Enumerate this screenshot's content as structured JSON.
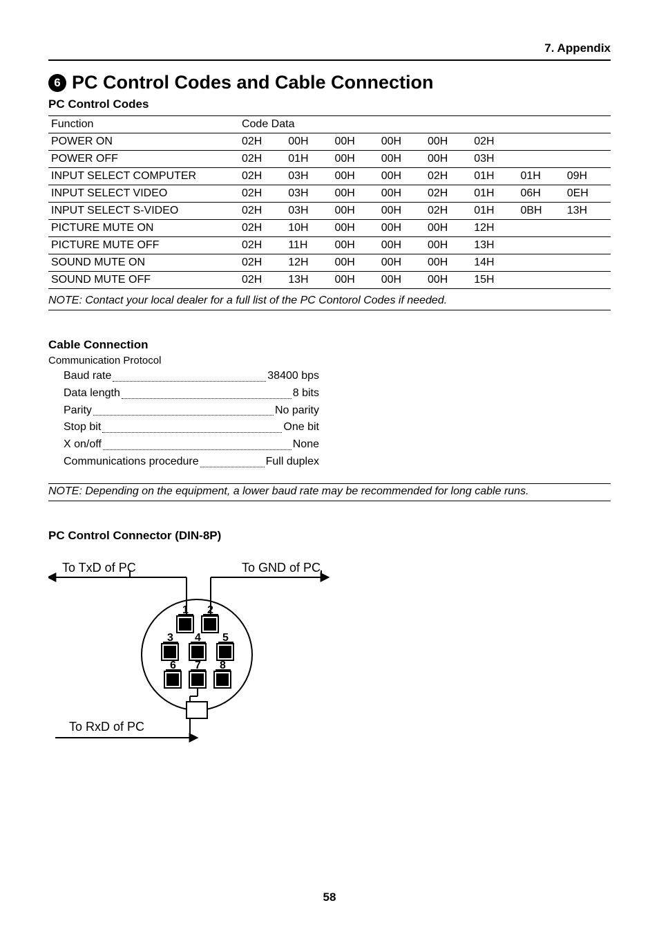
{
  "appendix_label": "7. Appendix",
  "section_number": "6",
  "main_title": "PC Control Codes and Cable Connection",
  "codes_title": "PC Control Codes",
  "codes_header_function": "Function",
  "codes_header_codedata": "Code Data",
  "chart_data": {
    "type": "table",
    "title": "PC Control Codes",
    "columns": [
      "Function",
      "Code Data"
    ],
    "rows": [
      {
        "function": "POWER ON",
        "codes": [
          "02H",
          "00H",
          "00H",
          "00H",
          "00H",
          "02H",
          "",
          ""
        ]
      },
      {
        "function": "POWER OFF",
        "codes": [
          "02H",
          "01H",
          "00H",
          "00H",
          "00H",
          "03H",
          "",
          ""
        ]
      },
      {
        "function": "INPUT SELECT COMPUTER",
        "codes": [
          "02H",
          "03H",
          "00H",
          "00H",
          "02H",
          "01H",
          "01H",
          "09H"
        ]
      },
      {
        "function": "INPUT SELECT VIDEO",
        "codes": [
          "02H",
          "03H",
          "00H",
          "00H",
          "02H",
          "01H",
          "06H",
          "0EH"
        ]
      },
      {
        "function": "INPUT SELECT S-VIDEO",
        "codes": [
          "02H",
          "03H",
          "00H",
          "00H",
          "02H",
          "01H",
          "0BH",
          "13H"
        ]
      },
      {
        "function": "PICTURE MUTE ON",
        "codes": [
          "02H",
          "10H",
          "00H",
          "00H",
          "00H",
          "12H",
          "",
          ""
        ]
      },
      {
        "function": "PICTURE MUTE OFF",
        "codes": [
          "02H",
          "11H",
          "00H",
          "00H",
          "00H",
          "13H",
          "",
          ""
        ]
      },
      {
        "function": "SOUND MUTE ON",
        "codes": [
          "02H",
          "12H",
          "00H",
          "00H",
          "00H",
          "14H",
          "",
          ""
        ]
      },
      {
        "function": "SOUND MUTE OFF",
        "codes": [
          "02H",
          "13H",
          "00H",
          "00H",
          "00H",
          "15H",
          "",
          ""
        ]
      }
    ]
  },
  "note1": "NOTE: Contact your local dealer for a full list of the PC Contorol Codes if needed.",
  "cable_title": "Cable Connection",
  "protocol_label": "Communication Protocol",
  "protocol": [
    {
      "label": "Baud rate",
      "value": "38400 bps"
    },
    {
      "label": "Data length",
      "value": "8 bits"
    },
    {
      "label": "Parity",
      "value": "No parity"
    },
    {
      "label": "Stop bit",
      "value": "One bit"
    },
    {
      "label": "X on/off",
      "value": "None"
    },
    {
      "label": "Communications procedure",
      "value": "Full duplex"
    }
  ],
  "note2": "NOTE: Depending on the equipment, a lower baud rate may be recommended for long cable runs.",
  "connector_title": "PC Control Connector (DIN-8P)",
  "diagram": {
    "txd_label": "To TxD of PC",
    "gnd_label": "To GND of PC",
    "rxd_label": "To RxD of PC",
    "pins": [
      "1",
      "2",
      "3",
      "4",
      "5",
      "6",
      "7",
      "8"
    ]
  },
  "page_number": "58"
}
